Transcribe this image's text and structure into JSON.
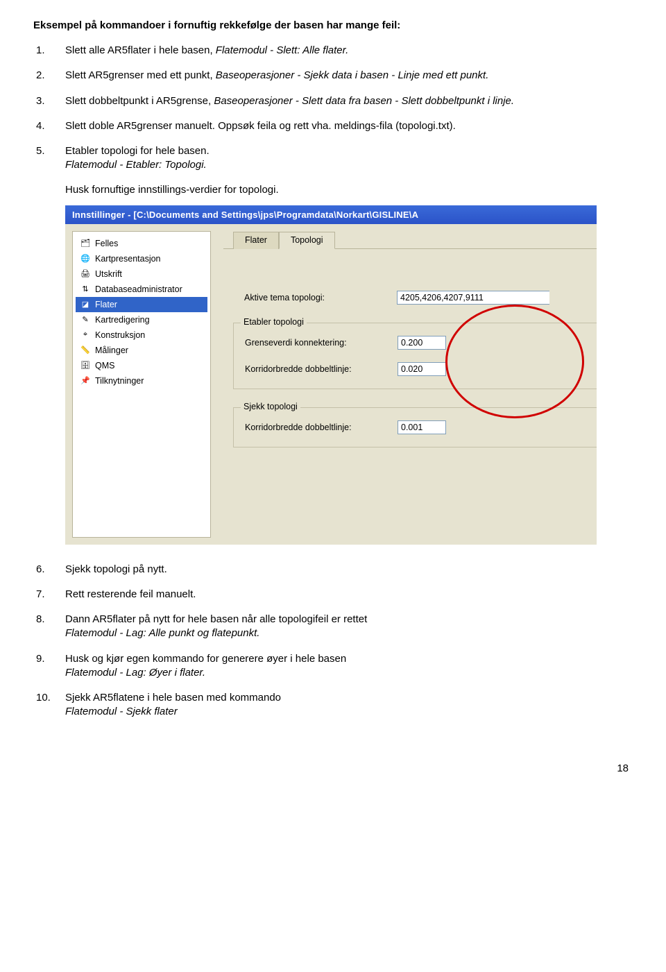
{
  "heading": "Eksempel på kommandoer i fornuftig rekkefølge der basen har mange feil:",
  "items": [
    {
      "n": "1.",
      "textA": "Slett alle AR5flater i hele basen, ",
      "ital": "Flatemodul - Slett: Alle flater.",
      "textB": ""
    },
    {
      "n": "2.",
      "textA": "Slett AR5grenser med ett punkt, ",
      "ital": "Baseoperasjoner - Sjekk data i basen - Linje med ett punkt.",
      "textB": ""
    },
    {
      "n": "3.",
      "textA": "Slett dobbeltpunkt i AR5grense, ",
      "ital": "Baseoperasjoner - Slett data fra basen - Slett dobbeltpunkt i linje.",
      "textB": ""
    },
    {
      "n": "4.",
      "textA": "Slett doble AR5grenser manuelt. Oppsøk feila og rett vha. meldings-fila (topologi.txt).",
      "ital": "",
      "textB": ""
    },
    {
      "n": "5.",
      "textA": "Etabler topologi for hele basen.",
      "ital": "Flatemodul - Etabler: Topologi.",
      "textB": "",
      "italBlock": true
    }
  ],
  "memo": "Husk fornuftige innstillings-verdier for topologi.",
  "window": {
    "title": "Innstillinger  - [C:\\Documents and Settings\\jps\\Programdata\\Norkart\\GISLINE\\A",
    "sidebar": [
      {
        "label": "Felles",
        "glyph": "🗂"
      },
      {
        "label": "Kartpresentasjon",
        "glyph": "🌐"
      },
      {
        "label": "Utskrift",
        "glyph": "🖨"
      },
      {
        "label": "Databaseadministrator",
        "glyph": "⇅"
      },
      {
        "label": "Flater",
        "glyph": "◪",
        "selected": true
      },
      {
        "label": "Kartredigering",
        "glyph": "✎"
      },
      {
        "label": "Konstruksjon",
        "glyph": "⌖"
      },
      {
        "label": "Målinger",
        "glyph": "📏"
      },
      {
        "label": "QMS",
        "glyph": "🗄"
      },
      {
        "label": "Tilknytninger",
        "glyph": "📌"
      }
    ],
    "tabs": {
      "t1": "Flater",
      "t2": "Topologi"
    },
    "group1": {
      "label": "Aktive tema topologi:",
      "value": "4205,4206,4207,9111"
    },
    "group2": {
      "legend": "Etabler topologi",
      "r1label": "Grenseverdi konnektering:",
      "r1value": "0.200",
      "r2label": "Korridorbredde dobbeltlinje:",
      "r2value": "0.020"
    },
    "group3": {
      "legend": "Sjekk topologi",
      "r1label": "Korridorbredde dobbeltlinje:",
      "r1value": "0.001"
    }
  },
  "itemsAfter": [
    {
      "n": "6.",
      "textA": "Sjekk topologi på nytt.",
      "ital": ""
    },
    {
      "n": "7.",
      "textA": "Rett resterende feil manuelt.",
      "ital": ""
    },
    {
      "n": "8.",
      "textA": "Dann AR5flater på nytt for hele basen når alle topologifeil er rettet",
      "ital": "Flatemodul  - Lag: Alle punkt og flatepunkt.",
      "italBlock": true
    },
    {
      "n": "9.",
      "textA": "Husk og kjør egen kommando for generere øyer i hele basen",
      "ital": "Flatemodul - Lag: Øyer i flater.",
      "italBlock": true
    },
    {
      "n": "10.",
      "textA": "Sjekk AR5flatene i hele basen med kommando",
      "ital": "Flatemodul - Sjekk flater",
      "italBlock": true
    }
  ],
  "pageNumber": "18"
}
